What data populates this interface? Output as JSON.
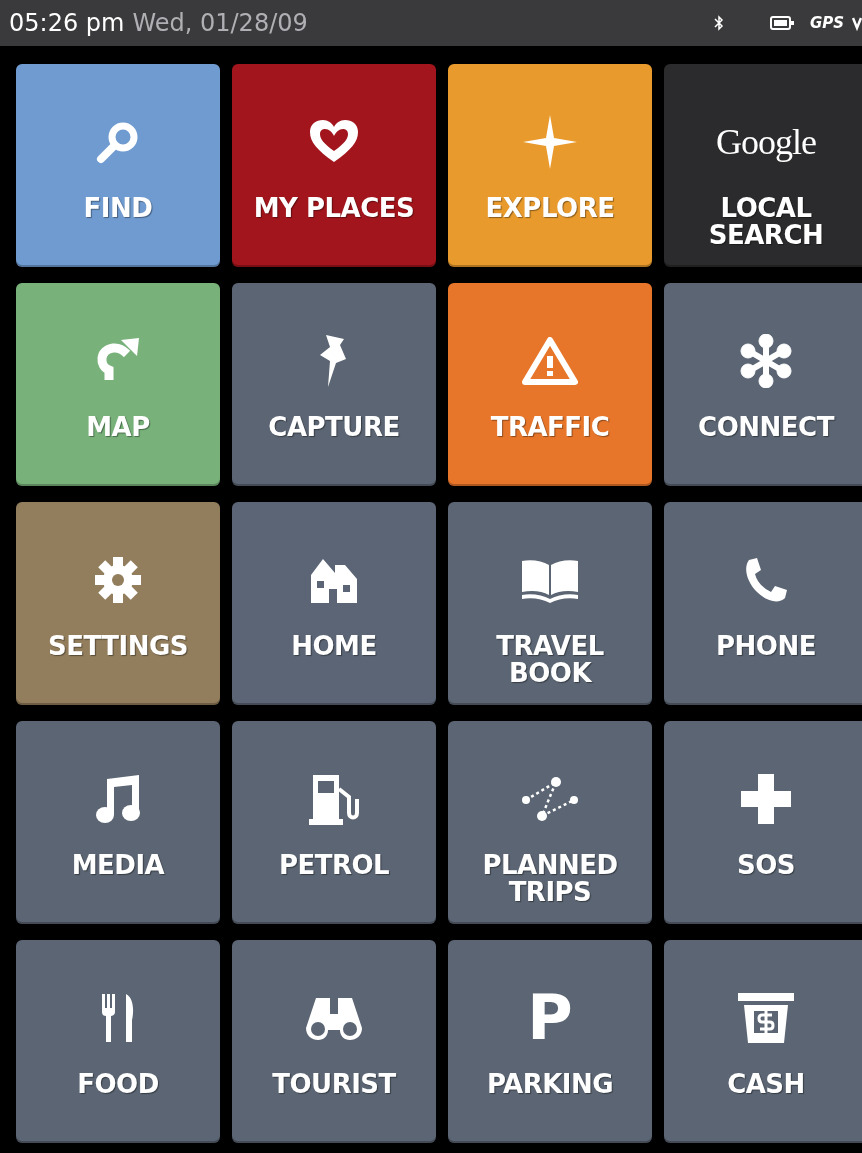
{
  "status_bar": {
    "time": "05:26 pm",
    "date": "Wed, 01/28/09",
    "gps": "GPS"
  },
  "tiles": [
    {
      "lines": [
        "FIND"
      ],
      "kind": "search",
      "color": "#6f9bd0"
    },
    {
      "lines": [
        "MY PLACES"
      ],
      "kind": "heart",
      "color": "#a2151c"
    },
    {
      "lines": [
        "EXPLORE"
      ],
      "kind": "sparkle",
      "color": "#e89a2c"
    },
    {
      "lines": [
        "LOCAL",
        "SEARCH"
      ],
      "kind": "logo",
      "logo_text": "Google",
      "color": "#2b2b2d"
    },
    {
      "lines": [
        "MAP"
      ],
      "kind": "turn",
      "color": "#78b27a"
    },
    {
      "lines": [
        "CAPTURE"
      ],
      "kind": "pin",
      "color": "#5b6573"
    },
    {
      "lines": [
        "TRAFFIC"
      ],
      "kind": "warning",
      "color": "#e8762a"
    },
    {
      "lines": [
        "CONNECT"
      ],
      "kind": "asterisk",
      "color": "#5b6573"
    },
    {
      "lines": [
        "SETTINGS"
      ],
      "kind": "gear",
      "color": "#927d5c"
    },
    {
      "lines": [
        "HOME"
      ],
      "kind": "house",
      "color": "#5b6575"
    },
    {
      "lines": [
        "TRAVEL",
        "BOOK"
      ],
      "kind": "book",
      "color": "#5b6573"
    },
    {
      "lines": [
        "PHONE"
      ],
      "kind": "phone",
      "color": "#5b6573"
    },
    {
      "lines": [
        "MEDIA"
      ],
      "kind": "note",
      "color": "#5b6573"
    },
    {
      "lines": [
        "PETROL"
      ],
      "kind": "fuel",
      "color": "#5b6573"
    },
    {
      "lines": [
        "PLANNED",
        "TRIPS"
      ],
      "kind": "route",
      "color": "#5b6573"
    },
    {
      "lines": [
        "SOS"
      ],
      "kind": "cross",
      "color": "#5b6573"
    },
    {
      "lines": [
        "FOOD"
      ],
      "kind": "cutlery",
      "color": "#5b6573"
    },
    {
      "lines": [
        "TOURIST"
      ],
      "kind": "binoculars",
      "color": "#5b6573"
    },
    {
      "lines": [
        "PARKING"
      ],
      "kind": "glyph",
      "glyph": "P",
      "color": "#5b6573"
    },
    {
      "lines": [
        "CASH"
      ],
      "kind": "cash",
      "color": "#5b6573"
    }
  ]
}
